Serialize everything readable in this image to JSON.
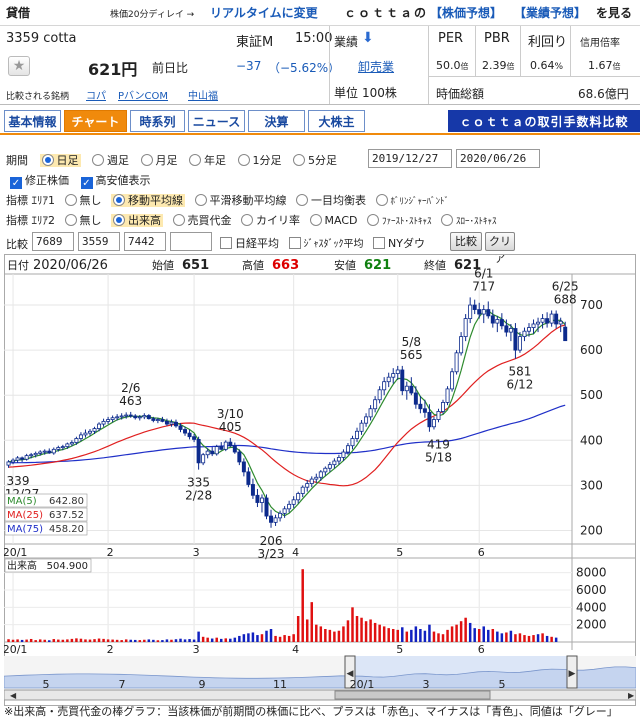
{
  "topbar": {
    "title": "貸借",
    "delay_note": "株価20分ディレイ →",
    "realtime_link": "リアルタイムに変更",
    "brand_text": "ｃｏｔｔａの",
    "link_stock": "【株価予想】",
    "link_earnings": "【業績予想】",
    "tail": "を見る"
  },
  "stock": {
    "code_name": "3359 cotta",
    "market": "東証M",
    "time": "15:00",
    "price": "621円",
    "change_label": "前日比",
    "change": "−37",
    "change_pct": "（−5.62%）",
    "compare_label": "比較される銘柄",
    "peers": [
      "コパ",
      "PバンCOM",
      "中山福"
    ]
  },
  "sector": {
    "label": "業績",
    "name": "卸売業",
    "unit_label": "単位",
    "unit_value": "100株"
  },
  "metrics": {
    "headers": [
      "PER",
      "PBR",
      "利回り",
      "信用倍率"
    ],
    "values": [
      "50.0",
      "2.39",
      "0.64",
      "1.67"
    ],
    "units": [
      "倍",
      "倍",
      "%",
      "倍"
    ],
    "cap_label": "時価総額",
    "cap_value": "68.6億円"
  },
  "tabs": [
    {
      "label": "基本情報",
      "active": false
    },
    {
      "label": "チャート",
      "active": true
    },
    {
      "label": "時系列",
      "active": false
    },
    {
      "label": "ニュース",
      "active": false
    },
    {
      "label": "決算",
      "active": false
    },
    {
      "label": "大株主",
      "active": false
    }
  ],
  "banner": "ｃｏｔｔａの取引手数料比較",
  "controls": {
    "period_label": "期間",
    "periods": [
      "日足",
      "週足",
      "月足",
      "年足",
      "1分足",
      "5分足"
    ],
    "period_active": 0,
    "date_from": "2019/12/27",
    "date_to": "2020/06/26",
    "chk_adjusted": "修正株価",
    "chk_highlow": "高安値表示",
    "ind1_label": "指標 ｴﾘｱ1",
    "ind1_opts": [
      "無し",
      "移動平均線",
      "平滑移動平均線",
      "一目均衡表",
      "ﾎﾞﾘﾝｼﾞｬｰﾊﾞﾝﾄﾞ"
    ],
    "ind1_active": 1,
    "ind2_label": "指標 ｴﾘｱ2",
    "ind2_opts": [
      "無し",
      "出来高",
      "売買代金",
      "カイリ率",
      "MACD",
      "ﾌｧｰｽﾄ･ｽﾄｷｬｽ",
      "ｽﾛｰ･ｽﾄｷｬｽ"
    ],
    "ind2_active": 1,
    "compare_label": "比較",
    "compare_codes": [
      "7689",
      "3559",
      "7442",
      ""
    ],
    "cmp_opts": [
      "日経平均",
      "ｼﾞｬｽﾀﾞｯｸ平均",
      "NYダウ"
    ],
    "btn_compare": "比較",
    "btn_clear": "クリア"
  },
  "ohlc": {
    "date_label": "日付",
    "date": "2020/06/26",
    "open_label": "始値",
    "open": "651",
    "high_label": "高値",
    "high": "663",
    "low_label": "安値",
    "low": "621",
    "close_label": "終値",
    "close": "621"
  },
  "ma_legend": [
    {
      "label": "MA(5)",
      "value": "642.80",
      "color": "#2e8b2e"
    },
    {
      "label": "MA(25)",
      "value": "637.52",
      "color": "#e02020"
    },
    {
      "label": "MA(75)",
      "value": "458.20",
      "color": "#2030c8"
    }
  ],
  "volume_legend": {
    "label": "出来高",
    "value": "504.900"
  },
  "footer_note": "※出来高・売買代金の棒グラフ：当該株価が前期間の株価に比べ、プラスは「赤色」、マイナスは「青色」、同値は「グレー」",
  "chart_data": {
    "type": "candlestick",
    "price_axis": {
      "ticks": [
        200,
        300,
        400,
        500,
        600,
        700
      ],
      "range": [
        170,
        760
      ]
    },
    "volume_axis": {
      "ticks": [
        2000,
        4000,
        6000,
        8000
      ],
      "range": [
        0,
        9000
      ]
    },
    "x_month_labels": [
      {
        "label": "20/1",
        "index": 1
      },
      {
        "label": "2",
        "index": 22
      },
      {
        "label": "3",
        "index": 41
      },
      {
        "label": "4",
        "index": 63
      },
      {
        "label": "5",
        "index": 86
      },
      {
        "label": "6",
        "index": 104
      }
    ],
    "annotations": [
      {
        "date": "2019/12/27",
        "lines": [
          "339",
          "12/27"
        ],
        "index": 0,
        "price": 339,
        "pos": "low"
      },
      {
        "date": "2020/02/06",
        "lines": [
          "2/6",
          "463"
        ],
        "index": 27,
        "price": 463,
        "pos": "high"
      },
      {
        "date": "2020/02/28",
        "lines": [
          "335",
          "2/28"
        ],
        "index": 42,
        "price": 335,
        "pos": "low"
      },
      {
        "date": "2020/03/10",
        "lines": [
          "3/10",
          "405"
        ],
        "index": 49,
        "price": 405,
        "pos": "high"
      },
      {
        "date": "2020/03/23",
        "lines": [
          "206",
          "3/23"
        ],
        "index": 58,
        "price": 206,
        "pos": "low"
      },
      {
        "date": "2020/05/08",
        "lines": [
          "5/8",
          "565"
        ],
        "index": 89,
        "price": 565,
        "pos": "high"
      },
      {
        "date": "2020/05/18",
        "lines": [
          "419",
          "5/18"
        ],
        "index": 95,
        "price": 419,
        "pos": "low"
      },
      {
        "date": "2020/06/01",
        "lines": [
          "6/1",
          "717"
        ],
        "index": 105,
        "price": 717,
        "pos": "high"
      },
      {
        "date": "2020/06/12",
        "lines": [
          "581",
          "6/12"
        ],
        "index": 113,
        "price": 581,
        "pos": "low"
      },
      {
        "date": "2020/06/25",
        "lines": [
          "6/25",
          "688"
        ],
        "index": 123,
        "price": 688,
        "pos": "high"
      }
    ],
    "candles": [
      [
        345,
        356,
        339,
        352
      ],
      [
        352,
        360,
        347,
        356
      ],
      [
        356,
        365,
        350,
        361
      ],
      [
        361,
        364,
        352,
        358
      ],
      [
        358,
        370,
        355,
        366
      ],
      [
        366,
        372,
        360,
        368
      ],
      [
        368,
        375,
        362,
        371
      ],
      [
        371,
        378,
        366,
        374
      ],
      [
        374,
        380,
        368,
        376
      ],
      [
        376,
        382,
        370,
        372
      ],
      [
        372,
        384,
        368,
        380
      ],
      [
        380,
        388,
        375,
        384
      ],
      [
        384,
        390,
        378,
        386
      ],
      [
        386,
        395,
        381,
        392
      ],
      [
        392,
        400,
        387,
        395
      ],
      [
        395,
        408,
        390,
        404
      ],
      [
        404,
        418,
        398,
        412
      ],
      [
        412,
        424,
        406,
        416
      ],
      [
        416,
        425,
        410,
        420
      ],
      [
        420,
        430,
        414,
        426
      ],
      [
        426,
        440,
        420,
        436
      ],
      [
        436,
        448,
        430,
        442
      ],
      [
        442,
        452,
        436,
        446
      ],
      [
        446,
        455,
        440,
        450
      ],
      [
        450,
        458,
        444,
        452
      ],
      [
        452,
        460,
        446,
        454
      ],
      [
        454,
        462,
        448,
        456
      ],
      [
        456,
        463,
        450,
        454
      ],
      [
        454,
        458,
        446,
        450
      ],
      [
        450,
        456,
        444,
        452
      ],
      [
        452,
        460,
        447,
        455
      ],
      [
        455,
        458,
        446,
        448
      ],
      [
        448,
        452,
        440,
        444
      ],
      [
        444,
        450,
        438,
        446
      ],
      [
        446,
        452,
        440,
        442
      ],
      [
        442,
        448,
        432,
        436
      ],
      [
        436,
        446,
        430,
        440
      ],
      [
        440,
        446,
        428,
        432
      ],
      [
        432,
        438,
        418,
        424
      ],
      [
        424,
        430,
        410,
        416
      ],
      [
        416,
        424,
        402,
        408
      ],
      [
        408,
        414,
        396,
        402
      ],
      [
        402,
        408,
        335,
        350
      ],
      [
        350,
        372,
        345,
        368
      ],
      [
        368,
        382,
        360,
        376
      ],
      [
        376,
        385,
        365,
        370
      ],
      [
        370,
        390,
        366,
        386
      ],
      [
        386,
        396,
        378,
        380
      ],
      [
        380,
        400,
        376,
        396
      ],
      [
        396,
        405,
        385,
        388
      ],
      [
        388,
        395,
        370,
        374
      ],
      [
        374,
        380,
        345,
        352
      ],
      [
        352,
        360,
        320,
        330
      ],
      [
        330,
        340,
        296,
        302
      ],
      [
        302,
        315,
        270,
        278
      ],
      [
        278,
        292,
        252,
        262
      ],
      [
        262,
        280,
        240,
        272
      ],
      [
        272,
        280,
        225,
        232
      ],
      [
        232,
        246,
        206,
        218
      ],
      [
        218,
        235,
        210,
        228
      ],
      [
        228,
        244,
        220,
        238
      ],
      [
        238,
        254,
        228,
        248
      ],
      [
        248,
        266,
        240,
        258
      ],
      [
        258,
        276,
        250,
        268
      ],
      [
        268,
        286,
        260,
        282
      ],
      [
        282,
        300,
        274,
        296
      ],
      [
        296,
        312,
        286,
        304
      ],
      [
        304,
        320,
        296,
        314
      ],
      [
        314,
        326,
        306,
        318
      ],
      [
        318,
        334,
        310,
        330
      ],
      [
        330,
        342,
        322,
        338
      ],
      [
        338,
        352,
        330,
        346
      ],
      [
        346,
        360,
        338,
        354
      ],
      [
        354,
        368,
        346,
        362
      ],
      [
        362,
        380,
        354,
        374
      ],
      [
        374,
        394,
        368,
        388
      ],
      [
        388,
        410,
        380,
        404
      ],
      [
        404,
        428,
        396,
        420
      ],
      [
        420,
        445,
        412,
        438
      ],
      [
        438,
        460,
        430,
        452
      ],
      [
        452,
        478,
        444,
        470
      ],
      [
        470,
        498,
        462,
        490
      ],
      [
        490,
        520,
        482,
        512
      ],
      [
        512,
        540,
        500,
        530
      ],
      [
        530,
        550,
        518,
        540
      ],
      [
        540,
        560,
        526,
        548
      ],
      [
        548,
        565,
        534,
        556
      ],
      [
        556,
        565,
        500,
        510
      ],
      [
        510,
        530,
        490,
        520
      ],
      [
        520,
        540,
        500,
        505
      ],
      [
        505,
        520,
        470,
        480
      ],
      [
        480,
        498,
        460,
        470
      ],
      [
        470,
        490,
        450,
        462
      ],
      [
        462,
        480,
        419,
        430
      ],
      [
        430,
        452,
        424,
        446
      ],
      [
        446,
        470,
        440,
        464
      ],
      [
        464,
        490,
        458,
        484
      ],
      [
        484,
        520,
        478,
        514
      ],
      [
        514,
        560,
        508,
        552
      ],
      [
        552,
        600,
        546,
        594
      ],
      [
        594,
        640,
        588,
        630
      ],
      [
        630,
        680,
        620,
        670
      ],
      [
        670,
        717,
        660,
        700
      ],
      [
        700,
        712,
        680,
        690
      ],
      [
        690,
        705,
        670,
        680
      ],
      [
        680,
        700,
        660,
        690
      ],
      [
        690,
        708,
        670,
        676
      ],
      [
        676,
        690,
        650,
        660
      ],
      [
        660,
        676,
        640,
        668
      ],
      [
        668,
        682,
        646,
        654
      ],
      [
        654,
        668,
        630,
        640
      ],
      [
        640,
        658,
        620,
        648
      ],
      [
        648,
        660,
        581,
        600
      ],
      [
        600,
        640,
        594,
        630
      ],
      [
        630,
        650,
        620,
        642
      ],
      [
        642,
        660,
        630,
        650
      ],
      [
        650,
        668,
        636,
        658
      ],
      [
        658,
        672,
        640,
        662
      ],
      [
        662,
        680,
        648,
        670
      ],
      [
        670,
        684,
        650,
        660
      ],
      [
        660,
        688,
        652,
        680
      ],
      [
        680,
        688,
        648,
        658
      ],
      [
        658,
        672,
        640,
        664
      ],
      [
        651,
        663,
        621,
        621
      ]
    ],
    "volume": [
      [
        320,
        1
      ],
      [
        260,
        1
      ],
      [
        300,
        1
      ],
      [
        240,
        0
      ],
      [
        280,
        1
      ],
      [
        350,
        1
      ],
      [
        220,
        1
      ],
      [
        300,
        1
      ],
      [
        260,
        1
      ],
      [
        200,
        0
      ],
      [
        340,
        1
      ],
      [
        280,
        1
      ],
      [
        260,
        1
      ],
      [
        300,
        1
      ],
      [
        360,
        1
      ],
      [
        420,
        1
      ],
      [
        380,
        1
      ],
      [
        300,
        1
      ],
      [
        280,
        1
      ],
      [
        330,
        1
      ],
      [
        400,
        1
      ],
      [
        360,
        1
      ],
      [
        300,
        1
      ],
      [
        280,
        1
      ],
      [
        250,
        1
      ],
      [
        220,
        1
      ],
      [
        300,
        1
      ],
      [
        260,
        0
      ],
      [
        240,
        0
      ],
      [
        220,
        1
      ],
      [
        260,
        1
      ],
      [
        300,
        0
      ],
      [
        250,
        0
      ],
      [
        200,
        1
      ],
      [
        220,
        0
      ],
      [
        300,
        0
      ],
      [
        260,
        1
      ],
      [
        320,
        0
      ],
      [
        380,
        0
      ],
      [
        300,
        0
      ],
      [
        340,
        0
      ],
      [
        280,
        0
      ],
      [
        1200,
        0
      ],
      [
        600,
        1
      ],
      [
        500,
        1
      ],
      [
        400,
        0
      ],
      [
        500,
        1
      ],
      [
        360,
        0
      ],
      [
        420,
        1
      ],
      [
        380,
        0
      ],
      [
        500,
        0
      ],
      [
        700,
        0
      ],
      [
        900,
        0
      ],
      [
        1000,
        0
      ],
      [
        1100,
        0
      ],
      [
        800,
        0
      ],
      [
        900,
        1
      ],
      [
        1300,
        0
      ],
      [
        1500,
        0
      ],
      [
        700,
        1
      ],
      [
        600,
        1
      ],
      [
        800,
        1
      ],
      [
        700,
        1
      ],
      [
        900,
        1
      ],
      [
        3000,
        1
      ],
      [
        8400,
        1
      ],
      [
        2600,
        1
      ],
      [
        4600,
        1
      ],
      [
        2000,
        1
      ],
      [
        1800,
        1
      ],
      [
        1500,
        1
      ],
      [
        1400,
        1
      ],
      [
        1200,
        1
      ],
      [
        1300,
        1
      ],
      [
        1800,
        1
      ],
      [
        2500,
        1
      ],
      [
        4000,
        1
      ],
      [
        3000,
        1
      ],
      [
        2800,
        1
      ],
      [
        2400,
        1
      ],
      [
        2600,
        1
      ],
      [
        2200,
        1
      ],
      [
        2000,
        1
      ],
      [
        1800,
        1
      ],
      [
        1600,
        1
      ],
      [
        1500,
        1
      ],
      [
        1400,
        1
      ],
      [
        1700,
        0
      ],
      [
        1200,
        1
      ],
      [
        1400,
        0
      ],
      [
        1800,
        0
      ],
      [
        1500,
        0
      ],
      [
        1300,
        0
      ],
      [
        2000,
        0
      ],
      [
        1200,
        1
      ],
      [
        1000,
        1
      ],
      [
        900,
        1
      ],
      [
        1400,
        1
      ],
      [
        1800,
        1
      ],
      [
        2000,
        1
      ],
      [
        2400,
        1
      ],
      [
        2800,
        1
      ],
      [
        2200,
        0
      ],
      [
        1600,
        0
      ],
      [
        1500,
        1
      ],
      [
        1800,
        0
      ],
      [
        1400,
        0
      ],
      [
        1500,
        1
      ],
      [
        1200,
        0
      ],
      [
        1000,
        0
      ],
      [
        1100,
        1
      ],
      [
        1300,
        0
      ],
      [
        900,
        1
      ],
      [
        1000,
        1
      ],
      [
        800,
        1
      ],
      [
        700,
        1
      ],
      [
        800,
        1
      ],
      [
        900,
        0
      ],
      [
        1000,
        1
      ],
      [
        700,
        0
      ],
      [
        600,
        1
      ],
      [
        505,
        0
      ]
    ]
  },
  "navigator": {
    "labels": [
      "5",
      "7",
      "9",
      "11",
      "20/1",
      "3",
      "5"
    ]
  }
}
